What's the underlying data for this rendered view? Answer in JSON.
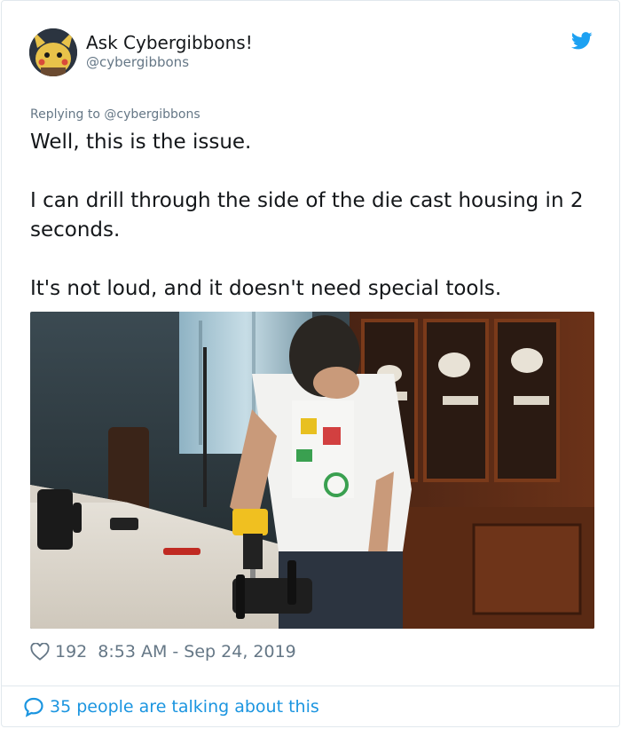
{
  "author": {
    "display_name": "Ask Cybergibbons!",
    "handle": "@cybergibbons"
  },
  "reply": {
    "label": "Replying to",
    "mention": "@cybergibbons"
  },
  "tweet": {
    "paragraphs": [
      "Well, this is the issue.",
      "I can drill through the side of the die cast housing in 2 seconds.",
      "It's not loud, and it doesn't need special tools."
    ]
  },
  "meta": {
    "likes": "192",
    "timestamp": "8:53 AM - Sep 24, 2019"
  },
  "footer": {
    "talking": "35 people are talking about this"
  },
  "icons": {
    "bird": "twitter-bird-icon",
    "heart": "heart-icon",
    "bubble": "speech-bubble-icon"
  },
  "colors": {
    "brand": "#1da1f2",
    "link": "#1b95e0",
    "secondary_text": "#657786",
    "border": "#e1e8ed"
  }
}
